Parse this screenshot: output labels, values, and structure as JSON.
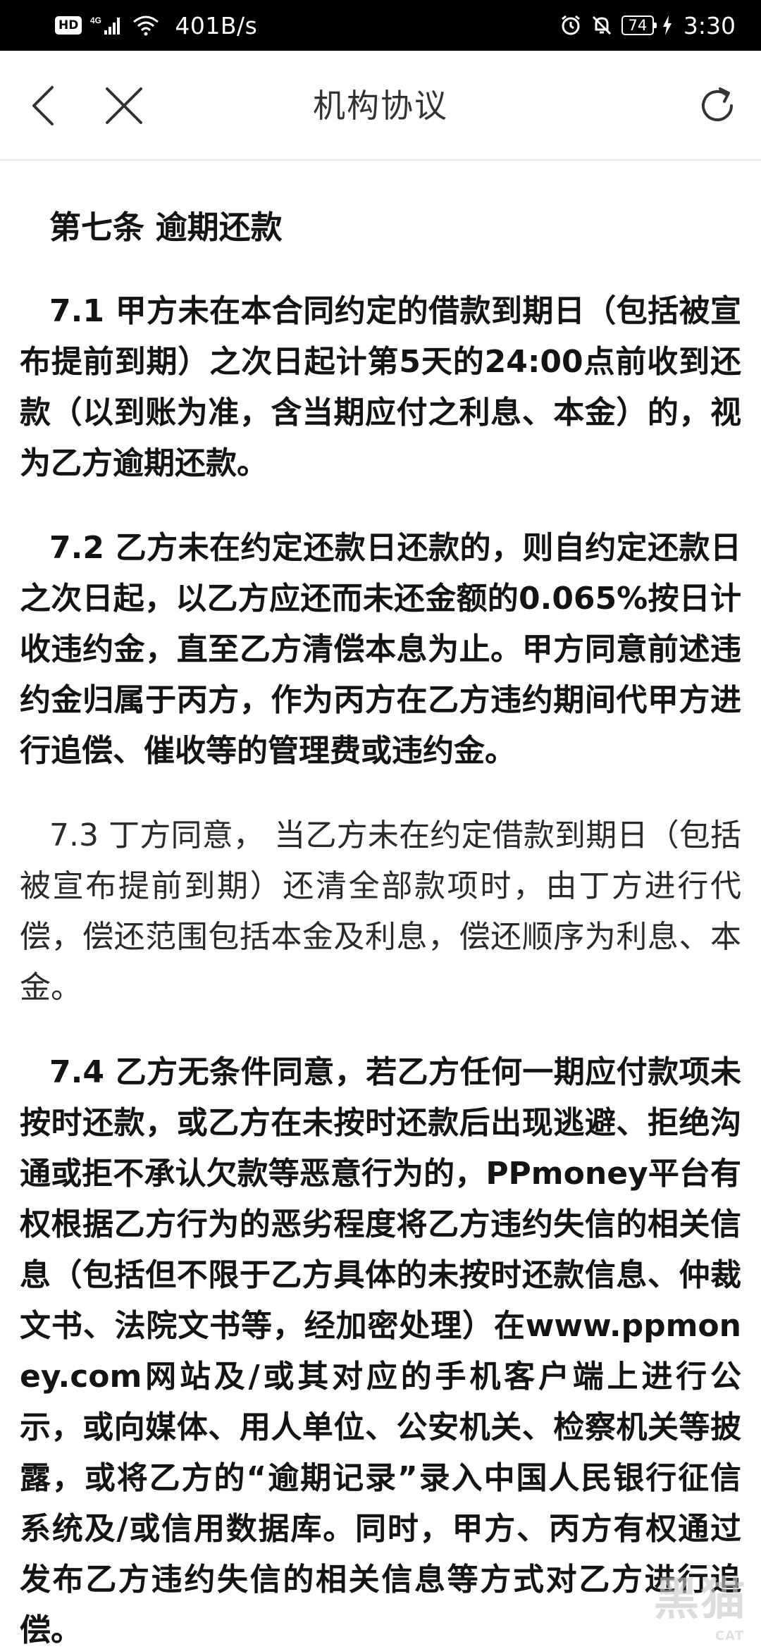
{
  "status_bar": {
    "hd": "HD",
    "network": "4G",
    "net_speed": "401B/s",
    "battery": "74",
    "time": "3:30",
    "icons": [
      "signal-icon",
      "wifi-icon",
      "alarm-icon",
      "mute-icon",
      "bolt-icon"
    ]
  },
  "header": {
    "title": "机构协议",
    "icons": [
      "back-icon",
      "close-icon",
      "refresh-icon"
    ]
  },
  "article": {
    "heading": "第七条 逾期还款",
    "paragraphs": [
      "7.1 甲方未在本合同约定的借款到期日（包括被宣布提前到期）之次日起计第5天的24:00点前收到还款（以到账为准，含当期应付之利息、本金）的，视为乙方逾期还款。",
      "7.2 乙方未在约定还款日还款的，则自约定还款日之次日起，以乙方应还而未还金额的0.065%按日计收违约金，直至乙方清偿本息为止。甲方同意前述违约金归属于丙方，作为丙方在乙方违约期间代甲方进行追偿、催收等的管理费或违约金。",
      "7.3 丁方同意， 当乙方未在约定借款到期日（包括被宣布提前到期）还清全部款项时，由丁方进行代偿，偿还范围包括本金及利息，偿还顺序为利息、本金。",
      "7.4 乙方无条件同意，若乙方任何一期应付款项未按时还款，或乙方在未按时还款后出现逃避、拒绝沟通或拒不承认欠款等恶意行为的，PPmoney平台有权根据乙方行为的恶劣程度将乙方违约失信的相关信息（包括但不限于乙方具体的未按时还款信息、仲裁文书、法院文书等，经加密处理）在www.ppmoney.com网站及/或其对应的手机客户端上进行公示，或向媒体、用人单位、公安机关、检察机关等披露，或将乙方的“逾期记录”录入中国人民银行征信系统及/或信用数据库。同时，甲方、丙方有权通过发布乙方违约失信的相关信息等方式对乙方进行追偿。"
    ]
  },
  "watermark": {
    "text": "黑猫",
    "sub": "CAT"
  }
}
